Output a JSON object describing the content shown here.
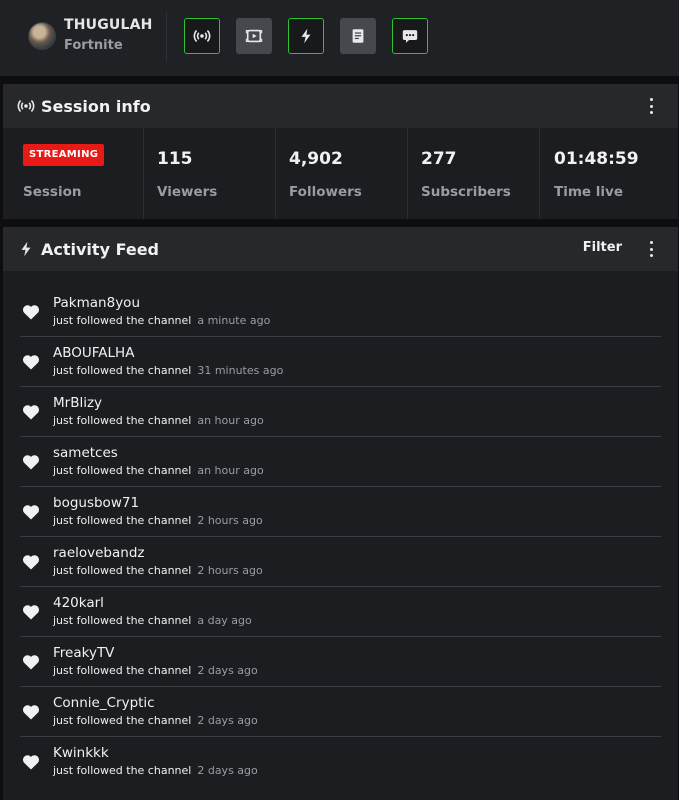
{
  "header": {
    "channel_name": "THUGULAH",
    "game": "Fortnite",
    "tools": [
      {
        "icon": "broadcast-icon",
        "active": true
      },
      {
        "icon": "screen-capture-icon",
        "active": false
      },
      {
        "icon": "lightning-icon",
        "active": true
      },
      {
        "icon": "document-icon",
        "active": false
      },
      {
        "icon": "chat-icon",
        "active": true
      }
    ],
    "accent_color": "#2fc22f"
  },
  "session_info": {
    "title": "Session info",
    "status_badge": "STREAMING",
    "stats": [
      {
        "label": "Session",
        "value": ""
      },
      {
        "label": "Viewers",
        "value": "115"
      },
      {
        "label": "Followers",
        "value": "4,902"
      },
      {
        "label": "Subscribers",
        "value": "277"
      },
      {
        "label": "Time live",
        "value": "01:48:59"
      }
    ]
  },
  "activity_feed": {
    "title": "Activity Feed",
    "filter_label": "Filter",
    "items": [
      {
        "user": "Pakman8you",
        "action": "just followed the channel",
        "time": "a minute ago"
      },
      {
        "user": "ABOUFALHA",
        "action": "just followed the channel",
        "time": "31 minutes ago"
      },
      {
        "user": "MrBlizy",
        "action": "just followed the channel",
        "time": "an hour ago"
      },
      {
        "user": "sametces",
        "action": "just followed the channel",
        "time": "an hour ago"
      },
      {
        "user": "bogusbow71",
        "action": "just followed the channel",
        "time": "2 hours ago"
      },
      {
        "user": "raelovebandz",
        "action": "just followed the channel",
        "time": "2 hours ago"
      },
      {
        "user": "420karl",
        "action": "just followed the channel",
        "time": "a day ago"
      },
      {
        "user": "FreakyTV",
        "action": "just followed the channel",
        "time": "2 days ago"
      },
      {
        "user": "Connie_Cryptic",
        "action": "just followed the channel",
        "time": "2 days ago"
      },
      {
        "user": "Kwinkkk",
        "action": "just followed the channel",
        "time": "2 days ago"
      }
    ]
  }
}
